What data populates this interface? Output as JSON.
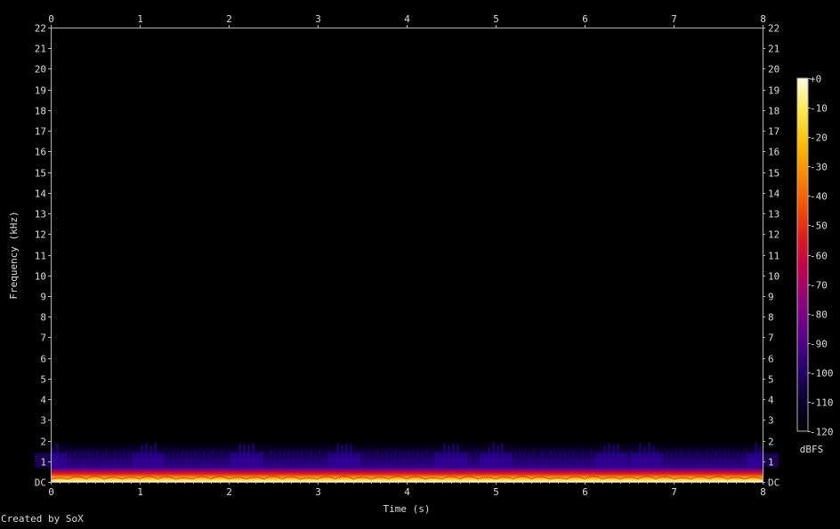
{
  "chart_data": {
    "type": "heatmap",
    "xlabel": "Time (s)",
    "ylabel": "Frequency (kHz)",
    "credit": "Created by SoX",
    "x_ticks": [
      "0",
      "1",
      "2",
      "3",
      "4",
      "5",
      "6",
      "7",
      "8"
    ],
    "xlim": [
      0,
      8
    ],
    "y_ticks": [
      "DC",
      "1",
      "2",
      "3",
      "4",
      "5",
      "6",
      "7",
      "8",
      "9",
      "10",
      "11",
      "12",
      "13",
      "14",
      "15",
      "16",
      "17",
      "18",
      "19",
      "20",
      "21",
      "22"
    ],
    "ylim": [
      0,
      22
    ],
    "colorbar": {
      "label": "dBFS",
      "ticks": [
        "+0",
        "-10",
        "-20",
        "-30",
        "-40",
        "-50",
        "-60",
        "-70",
        "-80",
        "-90",
        "-100",
        "-110",
        "-120"
      ],
      "range": [
        -120,
        0
      ],
      "colors": [
        "#000000",
        "#0a0030",
        "#2a0070",
        "#5a008c",
        "#8c0080",
        "#bd0050",
        "#e01820",
        "#f55000",
        "#fd8a00",
        "#ffc000",
        "#ffea50",
        "#fffbe0"
      ]
    },
    "energy_band": {
      "peak_band_khz": [
        0,
        0.7
      ],
      "fringe_top_khz": 2.1,
      "loud_bursts_s": [
        0.0,
        1.1,
        2.2,
        3.3,
        4.5,
        5.0,
        6.3,
        6.7,
        8.0
      ]
    },
    "colors": {
      "background": "#000000",
      "frame": "#b4b4b4",
      "text": "#dcdcdc"
    }
  }
}
